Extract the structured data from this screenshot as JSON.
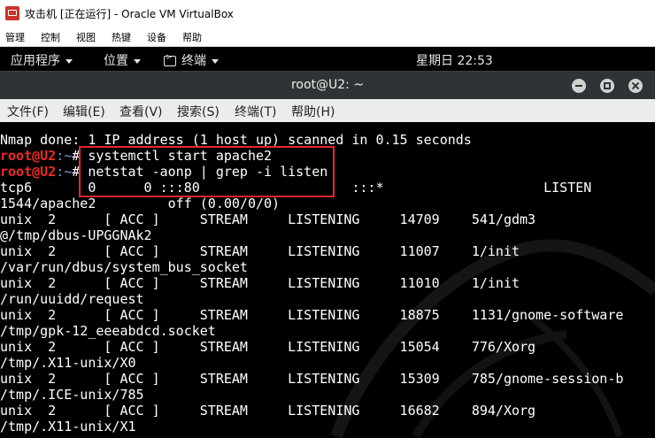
{
  "vbox": {
    "window_title": "攻击机 [正在运行] - Oracle VM VirtualBox",
    "menu": [
      "管理",
      "控制",
      "视图",
      "热键",
      "设备",
      "帮助"
    ]
  },
  "topbar": {
    "apps": "应用程序",
    "places": "位置",
    "terminal": "终端",
    "clock": "星期日 22:53"
  },
  "terminal_window": {
    "title": "root@U2: ~",
    "menu": [
      "文件(F)",
      "编辑(E)",
      "查看(V)",
      "搜索(S)",
      "终端(T)",
      "帮助(H)"
    ]
  },
  "prompt": {
    "user": "root@U2",
    "path": ":~",
    "symbol": "#"
  },
  "output": {
    "nmap_done": "Nmap done: 1 IP address (1 host up) scanned in 0.15 seconds",
    "cmd1": " systemctl start apache2",
    "cmd2": " netstat -aonp | grep -i listen",
    "l4": "tcp6       0      0 :::80                   :::*                    LISTEN",
    "l5": "1544/apache2         off (0.00/0/0)",
    "l6": "unix  2      [ ACC ]     STREAM     LISTENING     14709    541/gdm3",
    "l7": "@/tmp/dbus-UPGGNAk2",
    "l8": "unix  2      [ ACC ]     STREAM     LISTENING     11007    1/init",
    "l9": "/var/run/dbus/system_bus_socket",
    "l10": "unix  2      [ ACC ]     STREAM     LISTENING     11010    1/init",
    "l11": "/run/uuidd/request",
    "l12": "unix  2      [ ACC ]     STREAM     LISTENING     18875    1131/gnome-software",
    "l13": "/tmp/gpk-12_eeeabdcd.socket",
    "l14": "unix  2      [ ACC ]     STREAM     LISTENING     15054    776/Xorg",
    "l15": "/tmp/.X11-unix/X0",
    "l16": "unix  2      [ ACC ]     STREAM     LISTENING     15309    785/gnome-session-b",
    "l17": "/tmp/.ICE-unix/785",
    "l18": "unix  2      [ ACC ]     STREAM     LISTENING     16682    894/Xorg",
    "l19": "/tmp/.X11-unix/X1"
  },
  "colors": {
    "prompt_user": "#ef2929",
    "prompt_path": "#729fcf",
    "highlight_box": "#e8262a",
    "terminal_bg": "#000000",
    "header_bg": "#2e3436"
  }
}
